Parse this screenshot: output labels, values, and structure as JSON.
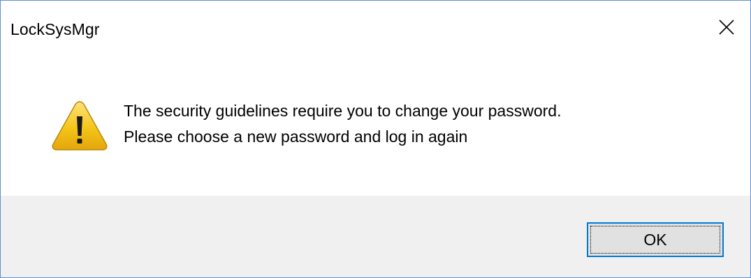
{
  "window": {
    "title": "LockSysMgr"
  },
  "icons": {
    "close": "close-icon",
    "warning": "warning-icon"
  },
  "message": {
    "line1": "The security guidelines require you to change your password.",
    "line2": "Please choose a new password and log in again"
  },
  "buttons": {
    "ok_label": "OK"
  },
  "colors": {
    "window_border": "#5b8fd6",
    "footer_bg": "#f0f0f0",
    "button_focus_border": "#0078d7",
    "warning_fill": "#f5c518"
  }
}
